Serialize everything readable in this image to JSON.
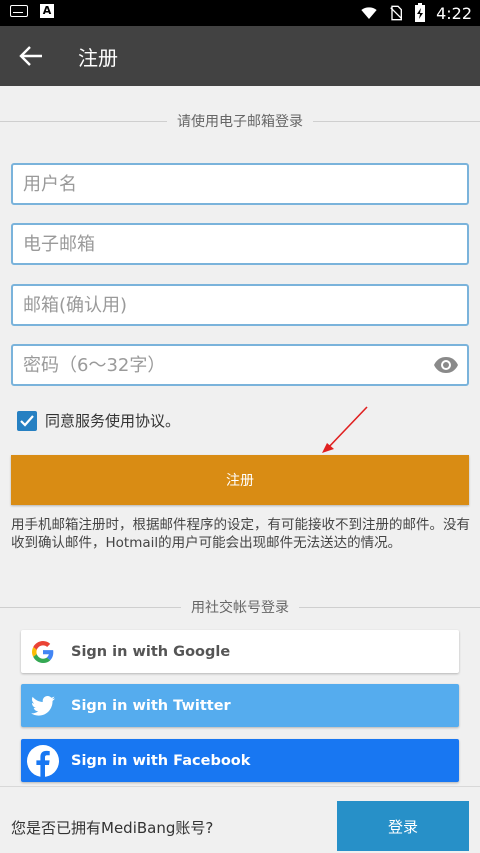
{
  "status_bar": {
    "time": "4:22"
  },
  "app_bar": {
    "title": "注册"
  },
  "email_section": {
    "heading": "请使用电子邮箱登录"
  },
  "form": {
    "username_placeholder": "用户名",
    "email_placeholder": "电子邮箱",
    "email_confirm_placeholder": "邮箱(确认用)",
    "password_placeholder": "密码（6～32字）",
    "agree_label": "同意服务使用协议。",
    "agree_checked": true,
    "register_label": "注册"
  },
  "notice": "用手机邮箱注册时，根据邮件程序的设定，有可能接收不到注册的邮件。没有收到确认邮件，Hotmail的用户可能会出现邮件无法送达的情况。",
  "social_section": {
    "heading": "用社交帐号登录",
    "google_label": "Sign in with Google",
    "twitter_label": "Sign in with Twitter",
    "facebook_label": "Sign in with Facebook"
  },
  "bottom": {
    "question": "您是否已拥有MediBang账号?",
    "login_label": "登录"
  },
  "colors": {
    "app_bar": "#424242",
    "accent_register": "#d98c14",
    "input_border": "#7ab3db",
    "checkbox": "#2680c2",
    "twitter": "#55acee",
    "facebook": "#1877f2",
    "login": "#2790c8"
  },
  "icons": [
    "keyboard-icon",
    "a-notification-icon",
    "wifi-icon",
    "no-sim-icon",
    "battery-charging-icon",
    "back-arrow-icon",
    "eye-icon",
    "check-icon",
    "google-logo-icon",
    "twitter-bird-icon",
    "facebook-logo-icon"
  ]
}
